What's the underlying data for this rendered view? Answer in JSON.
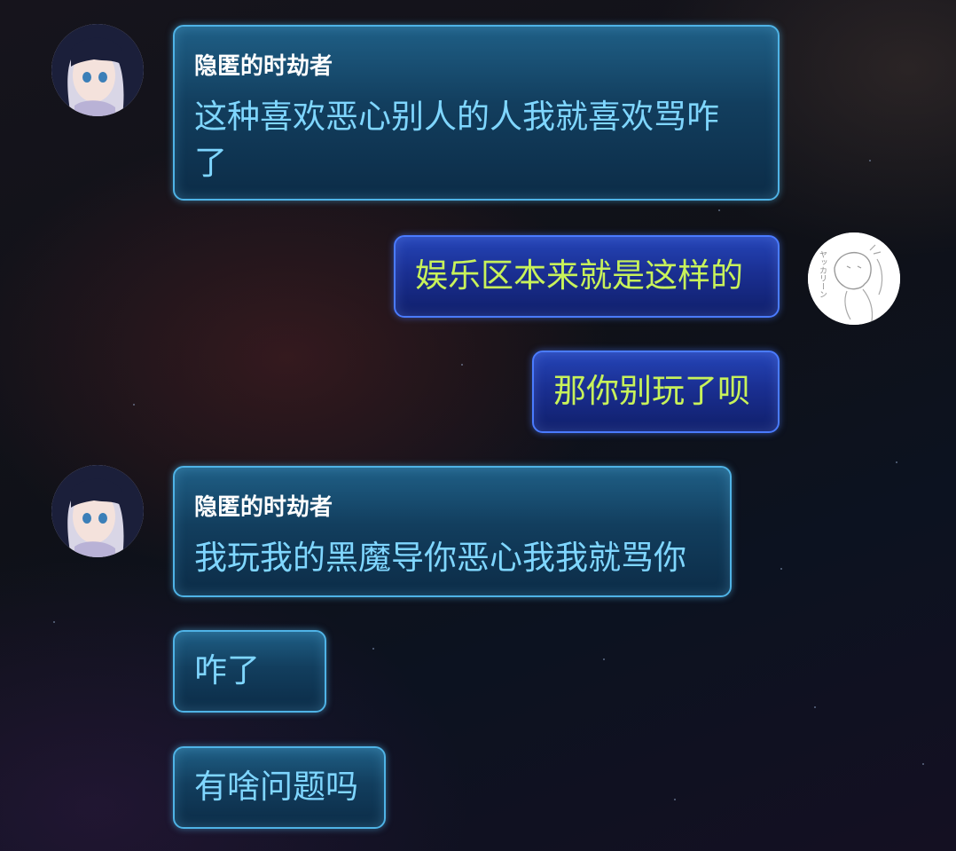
{
  "messages": [
    {
      "side": "left",
      "sender": "隐匿的时劫者",
      "lines": [
        "这种喜欢恶心别人的人我就喜欢骂咋",
        "了"
      ]
    },
    {
      "side": "right",
      "lines": [
        "娱乐区本来就是这样的"
      ]
    },
    {
      "side": "right",
      "lines": [
        "那你别玩了呗"
      ]
    },
    {
      "side": "left",
      "sender": "隐匿的时劫者",
      "lines": [
        "我玩我的黑魔导你恶心我我就骂你"
      ]
    },
    {
      "side": "left",
      "lines": [
        "咋了"
      ]
    },
    {
      "side": "left",
      "lines": [
        "有啥问题吗"
      ]
    }
  ],
  "avatars": {
    "left": {
      "icon": "anime-girl-avatar-icon"
    },
    "right": {
      "icon": "sketch-avatar-icon",
      "caption": "ヤッカリーン"
    }
  },
  "colors": {
    "left_bubble_border": "#4fb3e6",
    "left_text": "#7fd6ff",
    "right_bubble_border": "#4a7bff",
    "right_text": "#c8f25a",
    "sender_text": "#ffffff"
  }
}
